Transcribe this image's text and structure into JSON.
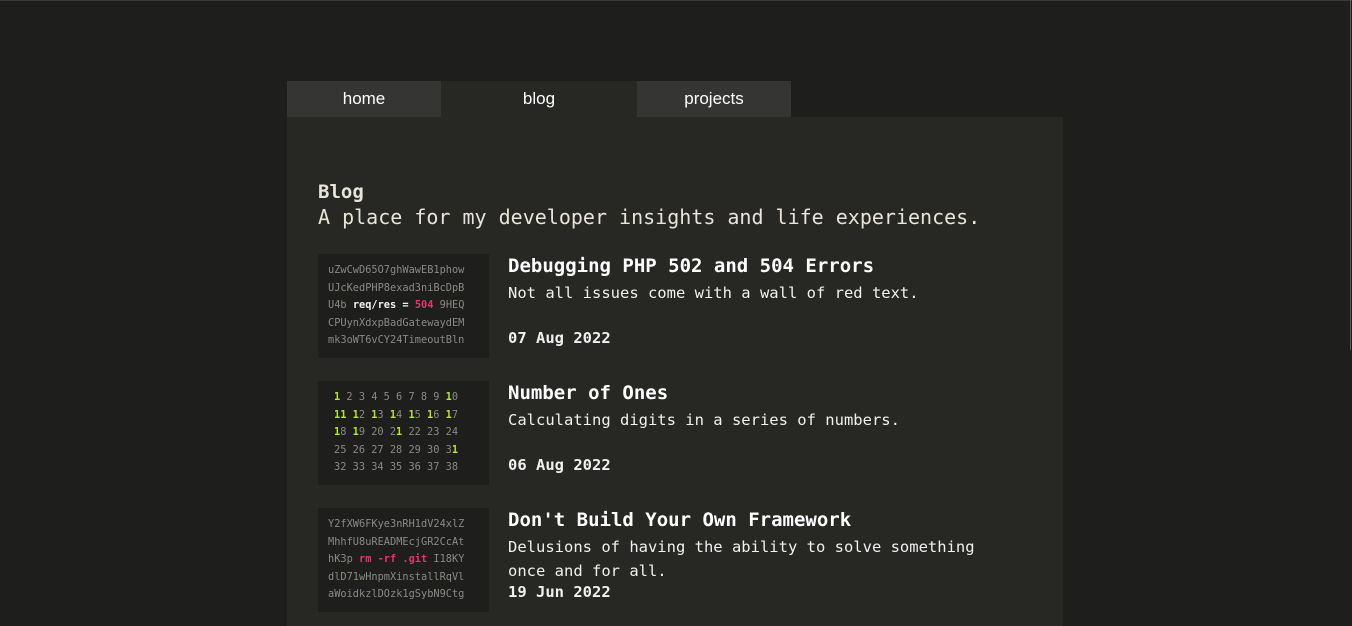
{
  "nav": {
    "tabs": [
      {
        "label": "home"
      },
      {
        "label": "blog",
        "active": true
      },
      {
        "label": "projects"
      }
    ]
  },
  "page": {
    "title": "Blog",
    "subtitle": "A place for my developer insights and life experiences."
  },
  "posts": [
    {
      "title": "Debugging PHP 502 and 504 Errors",
      "description": "Not all issues come with a wall of red text.",
      "date": "07 Aug 2022",
      "thumb_lines": [
        "uZwCwD65O7ghWawEB1phow",
        "UJcKedPHP8exad3niBcDpB",
        "U4b ",
        "req/res = ",
        "504",
        " 9HEQ",
        "CPUynXdxpBadGatewaydEM",
        "mk3oWT6vCY24TimeoutBln"
      ]
    },
    {
      "title": "Number of Ones",
      "description": "Calculating digits in a series of numbers.",
      "date": "06 Aug 2022"
    },
    {
      "title": "Don't Build Your Own Framework",
      "description": "Delusions of having the ability to solve something once and for all.",
      "date": "19 Jun 2022",
      "thumb_lines": [
        "Y2fXW6FKye3nRH1dV24xlZ",
        "MhhfU8uREADMEcjGR2CcAt",
        "hK3p ",
        "rm -rf .git",
        " I18KY",
        "dlD71wHnpmXinstallRqVl",
        "aWoidkzlDOzk1gSybN9Ctg"
      ]
    }
  ],
  "colors": {
    "background": "#1e1e1c",
    "panel": "#272724",
    "tab_inactive": "#353533",
    "accent_pink": "#e8336e",
    "accent_green": "#b2e632"
  }
}
